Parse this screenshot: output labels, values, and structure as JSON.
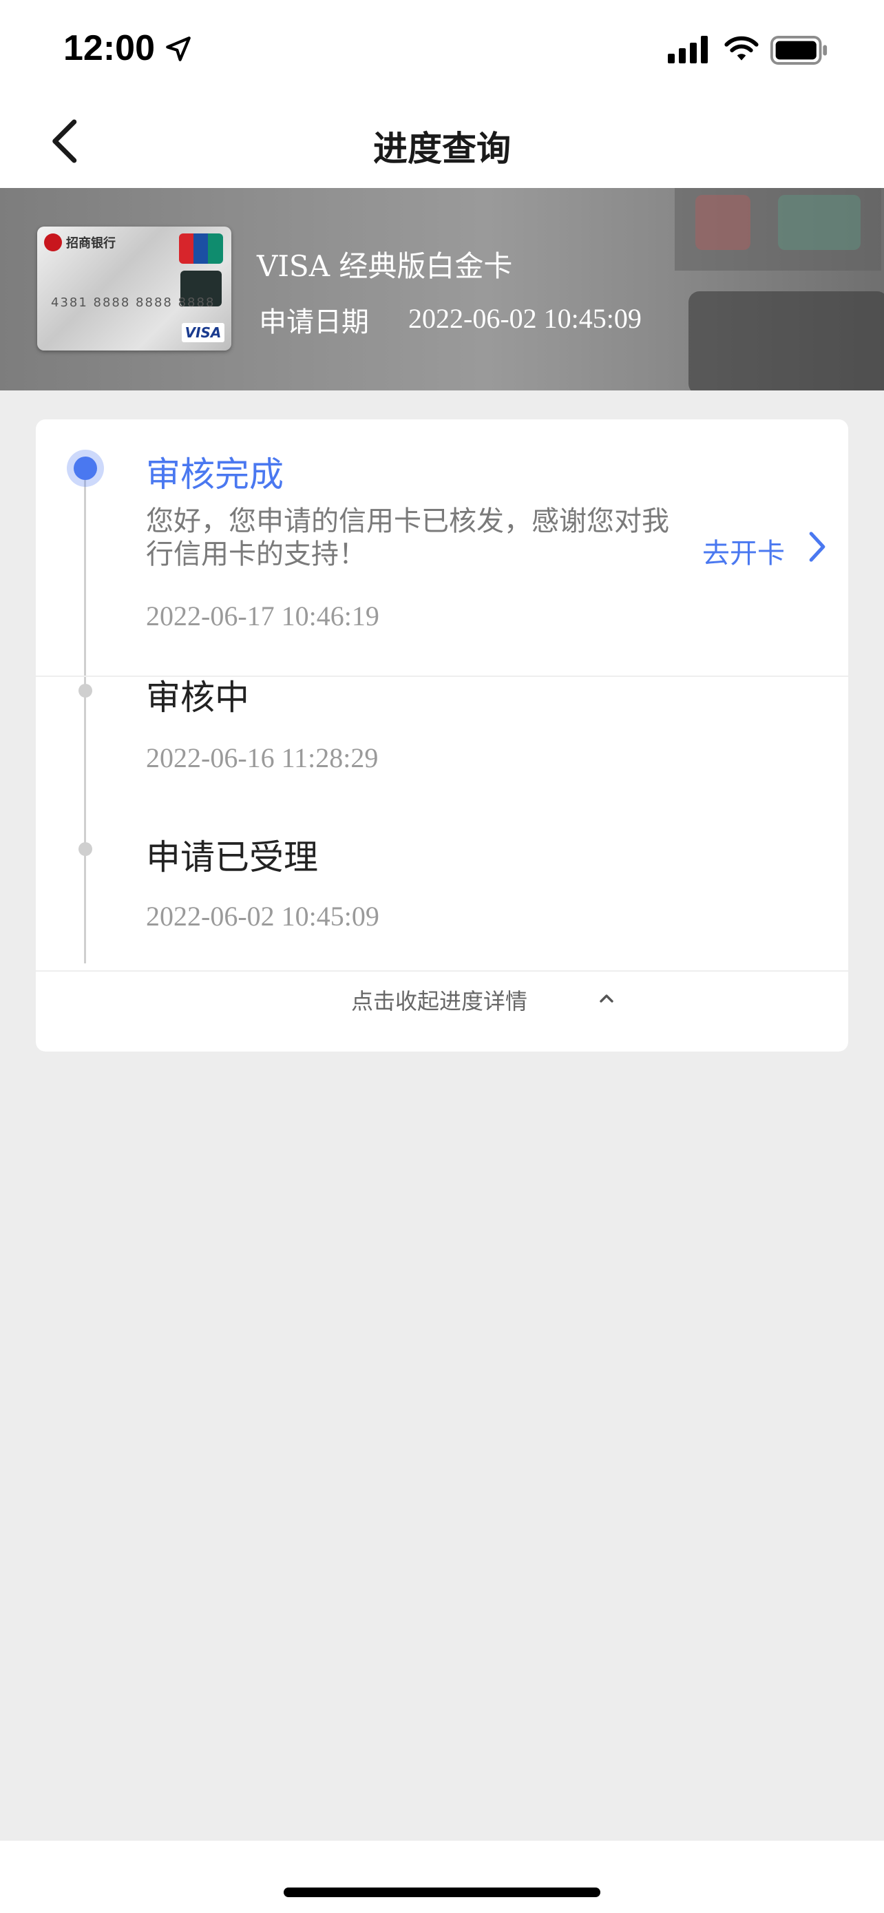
{
  "status_bar": {
    "time": "12:00",
    "icons": [
      "location-arrow-icon",
      "signal-icon",
      "wifi-icon",
      "battery-icon"
    ]
  },
  "nav": {
    "title": "进度查询",
    "back_icon": "chevron-left-icon"
  },
  "banner": {
    "card_name": "VISA 经典版白金卡",
    "apply_label": "申请日期",
    "apply_date": "2022-06-02 10:45:09",
    "card_image": {
      "bank": "招商银行",
      "number": "4381 8888 8888 8888",
      "network": "VISA"
    }
  },
  "progress": {
    "steps": [
      {
        "title": "审核完成",
        "description": "您好，您申请的信用卡已核发，感谢您对我行信用卡的支持！",
        "time": "2022-06-17 10:46:19",
        "active": true,
        "action_label": "去开卡"
      },
      {
        "title": "审核中",
        "time": "2022-06-16 11:28:29",
        "active": false
      },
      {
        "title": "申请已受理",
        "time": "2022-06-02 10:45:09",
        "active": false
      }
    ],
    "collapse_label": "点击收起进度详情"
  },
  "colors": {
    "accent": "#4a78f0",
    "background": "#ededed",
    "card": "#ffffff",
    "muted_text": "#9a9a9a"
  }
}
